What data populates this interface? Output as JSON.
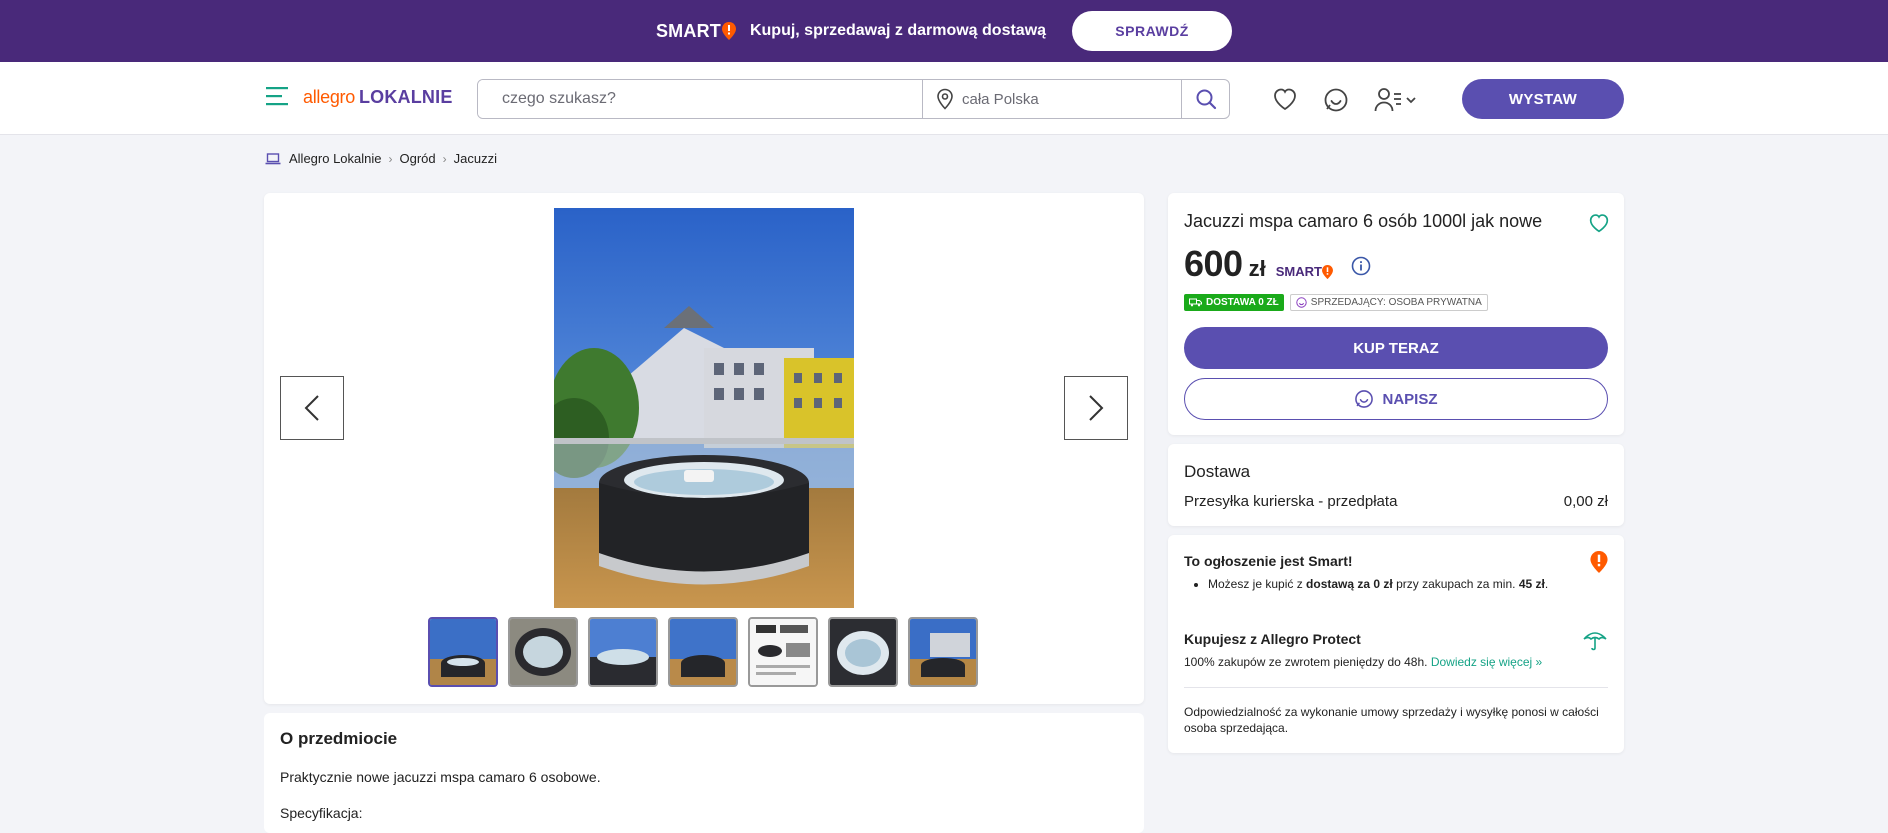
{
  "promo": {
    "smart_label": "SMART",
    "text": "Kupuj, sprzedawaj z darmową dostawą",
    "button": "SPRAWDŹ"
  },
  "header": {
    "logo_left": "allegro",
    "logo_right": "LOKALNIE",
    "search_placeholder": "czego szukasz?",
    "location_placeholder": "cała Polska",
    "wystaw_label": "WYSTAW"
  },
  "breadcrumb": [
    "Allegro Lokalnie",
    "Ogród",
    "Jacuzzi"
  ],
  "gallery": {
    "thumbnail_count": 7,
    "active_index": 0
  },
  "about": {
    "heading": "O przedmiocie",
    "description": "Praktycznie nowe jacuzzi mspa camaro 6 osobowe.",
    "spec_label": "Specyfikacja:"
  },
  "offer": {
    "title": "Jacuzzi mspa camaro 6 osób 1000l jak nowe",
    "price": "600",
    "currency": "zł",
    "smart_label": "SMART",
    "badge_delivery": "DOSTAWA 0 ZŁ",
    "badge_seller": "SPRZEDAJĄCY: OSOBA PRYWATNA",
    "buy_label": "KUP TERAZ",
    "message_label": "NAPISZ"
  },
  "delivery": {
    "heading": "Dostawa",
    "method": "Przesyłka kurierska - przedpłata",
    "cost": "0,00 zł"
  },
  "smart_info": {
    "title": "To ogłoszenie jest Smart!",
    "bullet_pre": "Możesz je kupić z ",
    "bullet_bold": "dostawą za 0 zł",
    "bullet_mid": " przy zakupach za min. ",
    "bullet_min": "45 zł",
    "bullet_end": "."
  },
  "protect": {
    "title": "Kupujesz z Allegro Protect",
    "text": "100% zakupów ze zwrotem pieniędzy do 48h. ",
    "link": "Dowiedz się więcej »"
  },
  "responsibility": "Odpowiedzialność za wykonanie umowy sprzedaży i wysyłkę ponosi w całości osoba sprzedająca.",
  "colors": {
    "brand_purple": "#49297a",
    "button_purple": "#5a4fb0",
    "allegro_orange": "#ff5a00",
    "teal": "#15a386",
    "green_badge": "#1aaa1a"
  },
  "icons": [
    "menu-icon",
    "location-pin-icon",
    "search-icon",
    "heart-icon",
    "chat-icon",
    "user-icon",
    "chevron-down-icon",
    "chevron-left-icon",
    "chevron-right-icon",
    "info-icon",
    "truck-icon",
    "smiley-icon",
    "smart-pin-icon",
    "umbrella-icon",
    "laptop-icon"
  ]
}
